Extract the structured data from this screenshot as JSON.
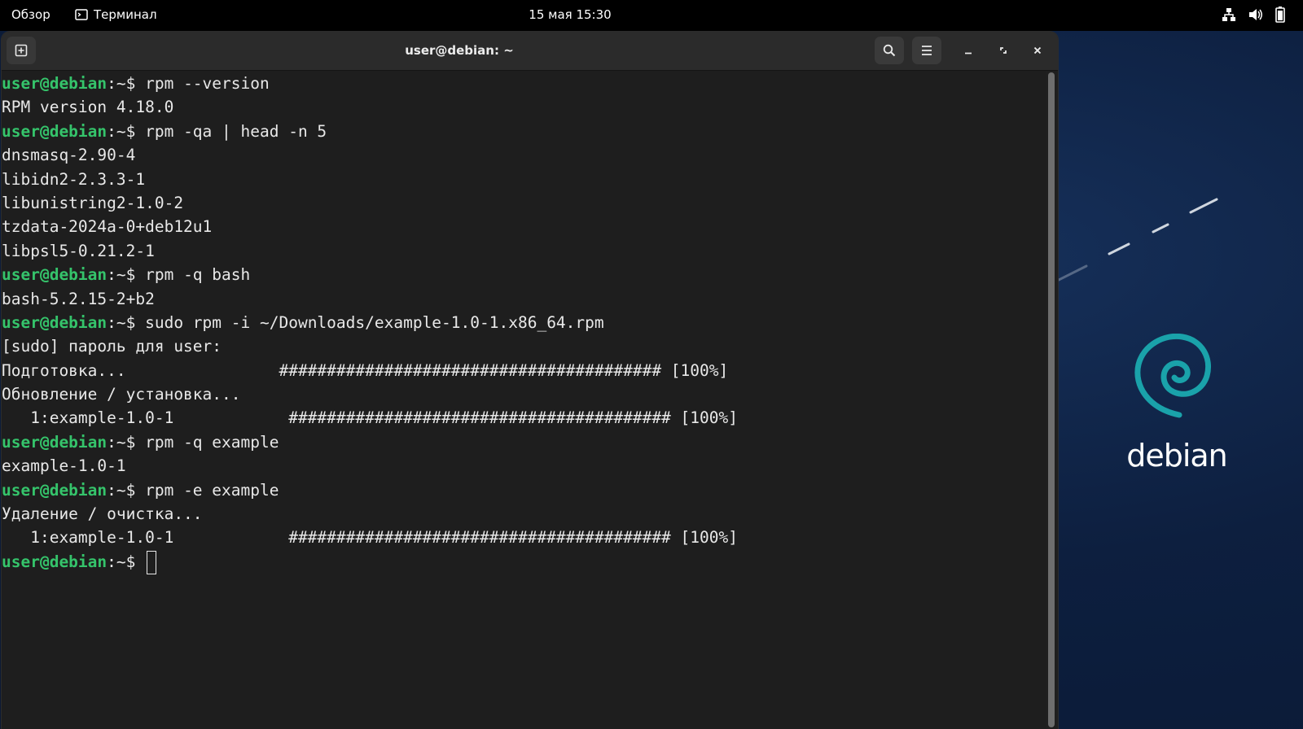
{
  "topbar": {
    "overview_label": "Обзор",
    "app_label": "Терминал",
    "clock": "15 мая 15:30",
    "status_icons": [
      "network-icon",
      "volume-icon",
      "battery-icon"
    ]
  },
  "window": {
    "title": "user@debian: ~",
    "buttons": [
      "new-tab-icon",
      "search-icon",
      "hamburger-menu-icon",
      "minimize-icon",
      "maximize-icon",
      "close-icon"
    ]
  },
  "terminal": {
    "prompt_user": "user@debian",
    "prompt_path": ":~$ ",
    "lines": [
      {
        "type": "prompt",
        "cmd": "rpm --version"
      },
      {
        "type": "out",
        "text": "RPM version 4.18.0"
      },
      {
        "type": "prompt",
        "cmd": "rpm -qa | head -n 5"
      },
      {
        "type": "out",
        "text": "dnsmasq-2.90-4"
      },
      {
        "type": "out",
        "text": "libidn2-2.3.3-1"
      },
      {
        "type": "out",
        "text": "libunistring2-1.0-2"
      },
      {
        "type": "out",
        "text": "tzdata-2024a-0+deb12u1"
      },
      {
        "type": "out",
        "text": "libpsl5-0.21.2-1"
      },
      {
        "type": "prompt",
        "cmd": "rpm -q bash"
      },
      {
        "type": "out",
        "text": "bash-5.2.15-2+b2"
      },
      {
        "type": "prompt",
        "cmd": "sudo rpm -i ~/Downloads/example-1.0-1.x86_64.rpm"
      },
      {
        "type": "out",
        "text": "[sudo] пароль для user:"
      },
      {
        "type": "out",
        "text": "Подготовка...                ######################################## [100%]"
      },
      {
        "type": "out",
        "text": "Обновление / установка..."
      },
      {
        "type": "out",
        "text": "   1:example-1.0-1            ######################################## [100%]"
      },
      {
        "type": "prompt",
        "cmd": "rpm -q example"
      },
      {
        "type": "out",
        "text": "example-1.0-1"
      },
      {
        "type": "prompt",
        "cmd": "rpm -e example"
      },
      {
        "type": "out",
        "text": "Удаление / очистка..."
      },
      {
        "type": "out",
        "text": "   1:example-1.0-1            ######################################## [100%]"
      },
      {
        "type": "prompt",
        "cmd": "",
        "cursor": true
      }
    ]
  },
  "desktop": {
    "wallpaper_brand": "debian"
  },
  "colors": {
    "prompt_user": "#35c46b",
    "terminal_bg": "#1e1e1e",
    "headerbar_bg": "#2b2b2b",
    "desktop_bg": "#0d1f3f",
    "debian_swirl": "#1aa2aa"
  }
}
